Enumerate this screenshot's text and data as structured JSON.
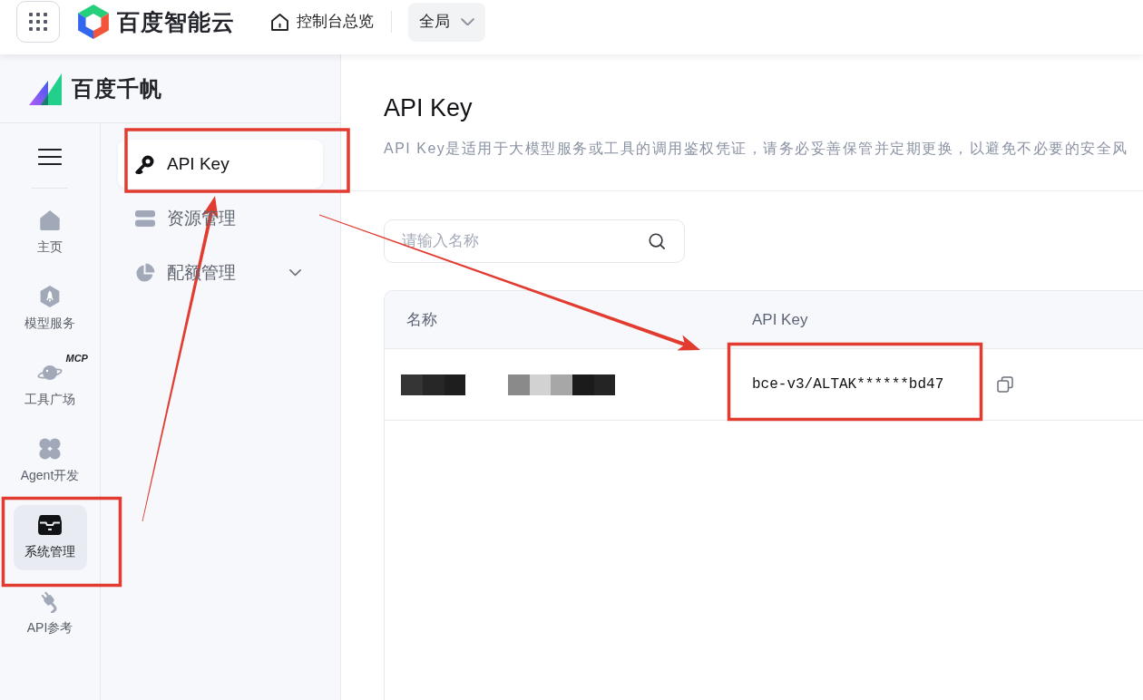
{
  "top_bar": {
    "brand": "百度智能云",
    "console_link": "控制台总览",
    "scope_select": {
      "value": "全局"
    }
  },
  "sidebar": {
    "product": "百度千帆",
    "rail_items": [
      {
        "label": "主页",
        "selected": false
      },
      {
        "label": "模型服务",
        "selected": false
      },
      {
        "label": "工具广场",
        "selected": false,
        "badge": "MCP"
      },
      {
        "label": "Agent开发",
        "selected": false
      },
      {
        "label": "系统管理",
        "selected": true
      },
      {
        "label": "API参考",
        "selected": false
      }
    ]
  },
  "submenu": {
    "items": [
      {
        "label": "API Key",
        "selected": true
      },
      {
        "label": "资源管理",
        "selected": false
      },
      {
        "label": "配额管理",
        "selected": false,
        "expanded": false
      }
    ]
  },
  "page": {
    "title": "API Key",
    "description": "API Key是适用于大模型服务或工具的调用鉴权凭证，请务必妥善保管并定期更换，以避免不必要的安全风",
    "search": {
      "placeholder": "请输入名称"
    },
    "table": {
      "columns": [
        "名称",
        "API Key"
      ],
      "rows": [
        {
          "name_masked": true,
          "api_key": "bce-v3/ALTAK******bd47"
        }
      ]
    }
  }
}
